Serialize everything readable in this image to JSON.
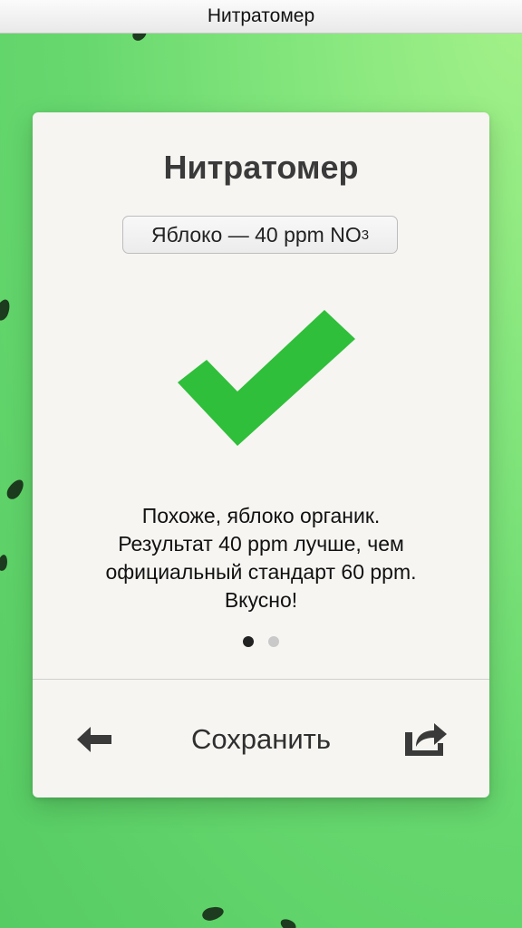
{
  "window": {
    "title": "Нитратомер"
  },
  "card": {
    "title": "Нитратомер",
    "result": {
      "product": "Яблоко",
      "separator": "—",
      "value": "40",
      "unit": "ppm",
      "compound": "NO",
      "compound_subscript": "3"
    },
    "status_icon": "checkmark-icon",
    "status_color": "#2fbf3a",
    "message_lines": [
      "Похоже, яблоко органик.",
      "Результат 40 ppm лучше, чем",
      "официальный стандарт 60 ppm.",
      "Вкусно!"
    ],
    "pagination": {
      "current": 1,
      "total": 2
    },
    "footer": {
      "back_icon": "arrow-left-icon",
      "save_label": "Сохранить",
      "share_icon": "share-icon"
    }
  },
  "colors": {
    "background_light": "#a4f189",
    "background_dark": "#56cc63",
    "card_background": "#f6f5f2",
    "text_dark": "#3a3a3a"
  }
}
